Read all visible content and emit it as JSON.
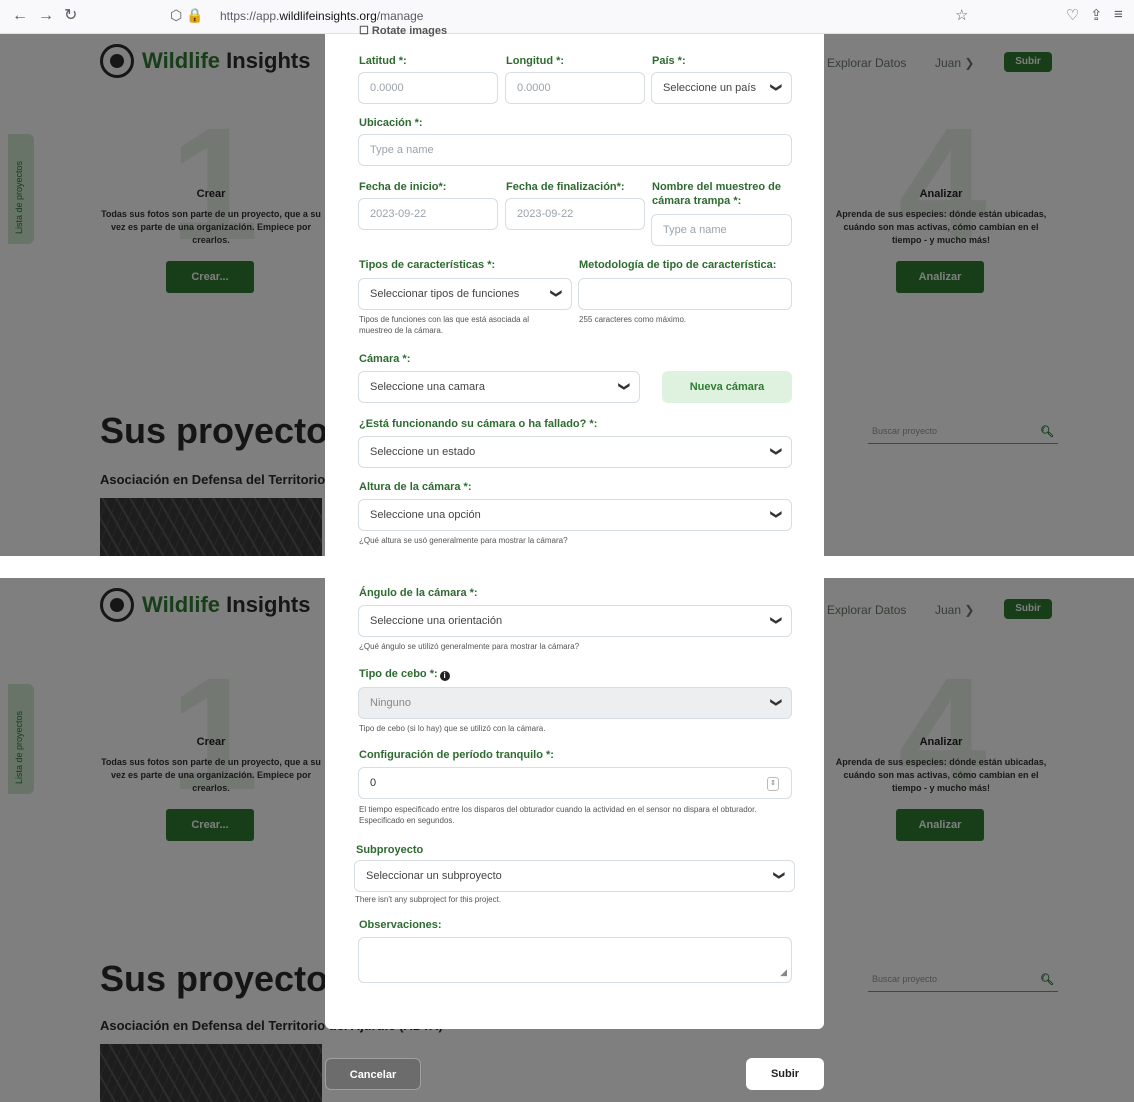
{
  "browser": {
    "back": "←",
    "forward": "→",
    "reload": "↻",
    "url_prefix": "https://app.",
    "url_domain": "wildlifeinsights.org",
    "url_path": "/manage",
    "star": "☆",
    "pocket": "♡",
    "share": "⇪",
    "menu": "≡"
  },
  "app": {
    "logo_word1": "Wildlife",
    "logo_word2": " Insights",
    "nav_explore": "Explorar Datos",
    "user_name": "Juan ❯",
    "upload_pill": "Subir",
    "side_tab": "Lista de proyectos",
    "step1": {
      "number": "1",
      "title": "Crear",
      "desc": "Todas sus fotos son parte de un proyecto, que a su vez es parte de una organización. Empiece por crearlos.",
      "button": "Crear..."
    },
    "step4": {
      "number": "4",
      "title": "Analizar",
      "desc": "Aprenda de sus especies: dónde están ubicadas, cuándo son mas activas, cómo cambian en el tiempo - y mucho más!",
      "button": "Analizar"
    },
    "projects_title": "Sus proyectos",
    "project_name_top": "Asociación en Defensa del Territorio c",
    "project_name_bottom": "Asociación en Defensa del Territorio del Ajuruie (ADTA)",
    "search_placeholder": "Buscar proyecto",
    "search_icon": "🔍"
  },
  "modal_top": {
    "rotate_images": "Rotate images",
    "lat_label": "Latitud *:",
    "lat_placeholder": "0.0000",
    "lon_label": "Longitud *:",
    "lon_placeholder": "0.0000",
    "country_label": "País *:",
    "country_placeholder": "Seleccione un país",
    "location_label": "Ubicación *:",
    "location_placeholder": "Type a name",
    "start_label": "Fecha de inicio*:",
    "start_value": "2023-09-22",
    "end_label": "Fecha de finalización*:",
    "end_value": "2023-09-22",
    "deployment_label": "Nombre del muestreo de cámara trampa *:",
    "deployment_placeholder": "Type a name",
    "feature_types_label": "Tipos de características *:",
    "feature_types_placeholder": "Seleccionar tipos de funciones",
    "feature_types_hint": "Tipos de funciones con las que está asociada al muestreo de la cámara.",
    "methodology_label": "Metodología de tipo de característica:",
    "methodology_hint": "255 caracteres como máximo.",
    "camera_label": "Cámara *:",
    "camera_placeholder": "Seleccione una camara",
    "new_camera_button": "Nueva cámara",
    "status_label": "¿Está funcionando su cámara o ha fallado? *:",
    "status_placeholder": "Seleccione un estado",
    "height_label": "Altura de la cámara *:",
    "height_placeholder": "Seleccione una opción",
    "height_hint": "¿Qué altura se usó generalmente para mostrar la cámara?"
  },
  "modal_bottom": {
    "angle_label": "Ángulo de la cámara *:",
    "angle_placeholder": "Seleccione una orientación",
    "angle_hint": "¿Qué ángulo se utilizó generalmente para mostrar la cámara?",
    "bait_label": "Tipo de cebo *:",
    "bait_value": "Ninguno",
    "bait_hint": "Tipo de cebo (si lo hay) que se utilizó con la cámara.",
    "quiet_label": "Configuración de período tranquilo *:",
    "quiet_value": "0",
    "quiet_hint": "El tiempo especificado entre los disparos del obturador cuando la actividad en el sensor no dispara el obturador. Especificado en segundos.",
    "subproject_label": "Subproyecto",
    "subproject_placeholder": "Seleccionar un subproyecto",
    "subproject_hint": "There isn't any subproject for this project.",
    "notes_label": "Observaciones:",
    "cancel_button": "Cancelar",
    "submit_button": "Subir"
  },
  "icons": {
    "chevron": "chevron-down-icon",
    "info": "info-icon",
    "search": "search-icon"
  }
}
